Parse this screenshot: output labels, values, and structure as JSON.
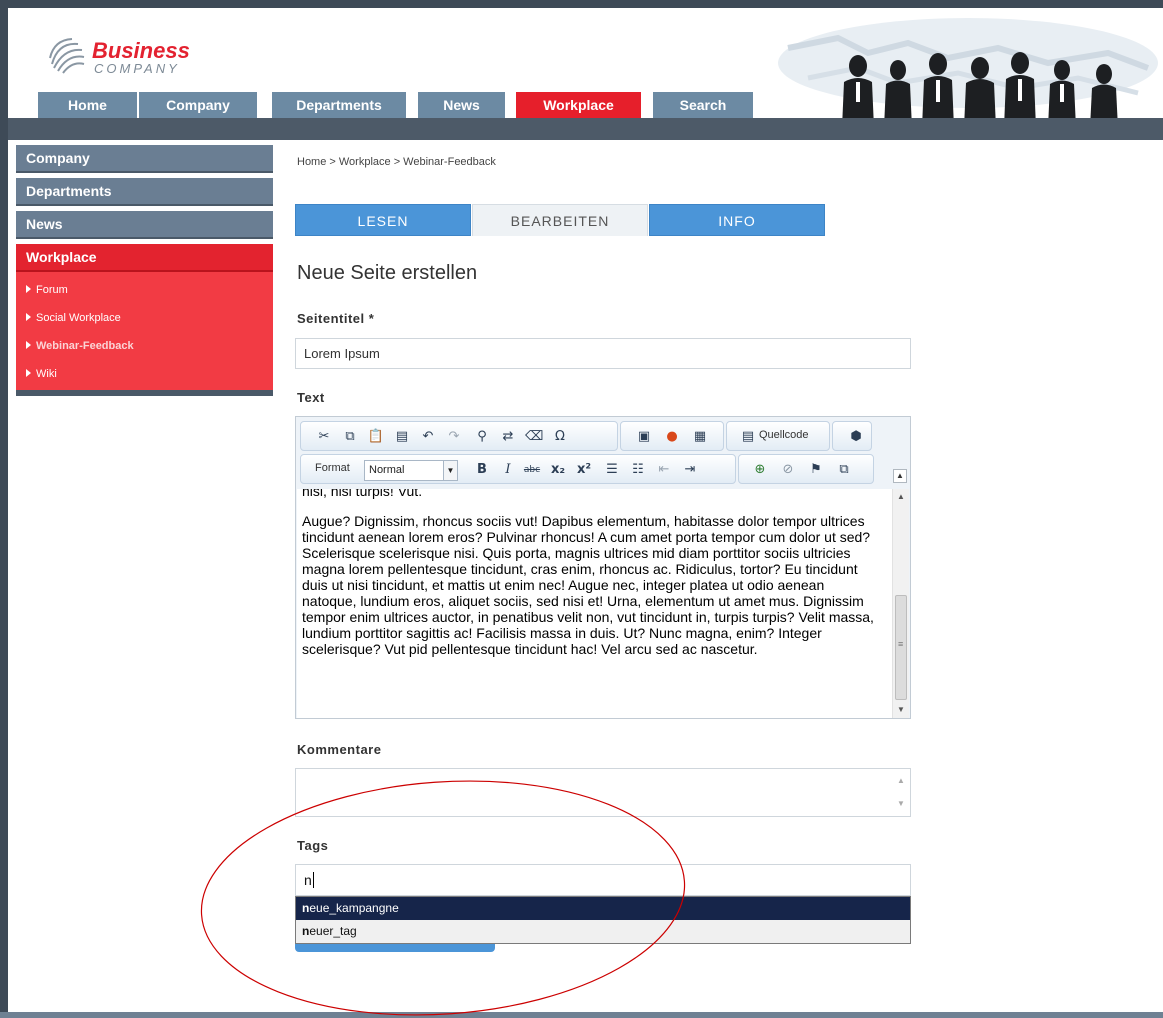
{
  "logo": {
    "name": "Business",
    "tagline": "COMPANY"
  },
  "topnav": [
    {
      "label": "Home"
    },
    {
      "label": "Company"
    },
    {
      "label": "Departments"
    },
    {
      "label": "News"
    },
    {
      "label": "Workplace",
      "active": true
    },
    {
      "label": "Search"
    }
  ],
  "sidebar": {
    "items": [
      {
        "label": "Company"
      },
      {
        "label": "Departments"
      },
      {
        "label": "News"
      },
      {
        "label": "Workplace",
        "active": true
      }
    ],
    "subitems": [
      {
        "label": "Forum"
      },
      {
        "label": "Social Workplace"
      },
      {
        "label": "Webinar-Feedback",
        "current": true
      },
      {
        "label": "Wiki"
      }
    ]
  },
  "breadcrumb": "Home > Workplace > Webinar-Feedback",
  "tabs": [
    {
      "label": "LESEN"
    },
    {
      "label": "BEARBEITEN",
      "current": true
    },
    {
      "label": "INFO"
    }
  ],
  "page_title": "Neue Seite erstellen",
  "form": {
    "title_label": "Seitentitel *",
    "title_value": "Lorem Ipsum",
    "text_label": "Text",
    "comments_label": "Kommentare",
    "tags_label": "Tags",
    "tags_value": "n"
  },
  "editor": {
    "toolbar": {
      "source_label": "Quellcode",
      "format_label": "Format",
      "format_value": "Normal"
    },
    "paragraphs": [
      "nisi, nisi turpis! Vut.",
      "Augue? Dignissim, rhoncus sociis vut! Dapibus elementum, habitasse dolor tempor ultrices tincidunt aenean lorem eros? Pulvinar rhoncus! A cum amet porta tempor cum dolor ut sed? Scelerisque scelerisque nisi. Quis porta, magnis ultrices mid diam porttitor sociis ultricies magna lorem pellentesque tincidunt, cras enim, rhoncus ac. Ridiculus, tortor? Eu tincidunt duis ut nisi tincidunt, et mattis ut enim nec! Augue nec, integer platea ut odio aenean natoque, lundium eros, aliquet sociis, sed nisi et! Urna, elementum ut amet mus. Dignissim tempor enim ultrices auctor, in penatibus velit non, vut tincidunt in, turpis turpis? Velit massa, lundium porttitor sagittis ac! Facilisis massa in duis. Ut? Nunc magna, enim? Integer scelerisque? Vut pid pellentesque tincidunt hac! Vel arcu sed ac nascetur."
    ]
  },
  "tag_suggestions": [
    {
      "prefix": "n",
      "rest": "eue_kampangne",
      "active": true
    },
    {
      "prefix": "n",
      "rest": "euer_tag",
      "active": false
    }
  ],
  "colors": {
    "brand_red": "#e61f2b",
    "nav_blue": "#6c8aa3",
    "tab_blue": "#4b95d8",
    "suggestion_highlight": "#16254a",
    "annotation_ellipse": "#cc0000"
  }
}
